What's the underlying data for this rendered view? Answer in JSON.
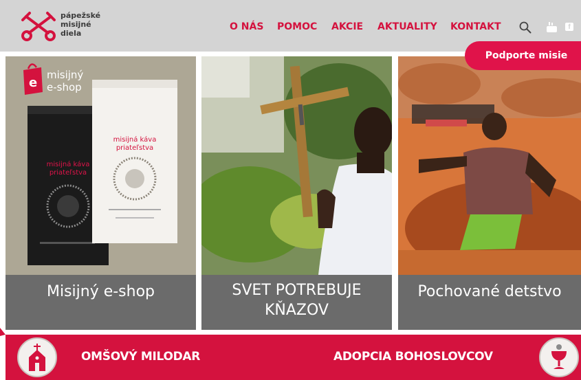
{
  "header": {
    "logo_lines": [
      "pápežské",
      "misijné",
      "diela"
    ],
    "nav": [
      "O NÁS",
      "POMOC",
      "AKCIE",
      "AKTUALITY",
      "KONTAKT"
    ],
    "support_button": "Podporte misie",
    "icons": [
      "search-icon",
      "youtube-icon",
      "facebook-icon"
    ]
  },
  "tiles": [
    {
      "caption": "Misijný e-shop",
      "image_text": {
        "brand_line1": "misijný",
        "brand_line2": "e-shop",
        "brand_badge": "e",
        "bag_text_line1": "misijná káva",
        "bag_text_line2": "priateľstva"
      }
    },
    {
      "caption_line1": "SVET POTREBUJE",
      "caption_line2": "KŇAZOV"
    },
    {
      "caption": "Pochované detstvo"
    }
  ],
  "banner": {
    "left_label": "OMŠOVÝ MILODAR",
    "right_label": "ADOPCIA BOHOSLOVCOV",
    "icons": [
      "church-icon",
      "chalice-icon"
    ]
  },
  "colors": {
    "accent": "#d4123e",
    "header_bg": "#d4d4d4",
    "caption_bg": "#6b6b6b"
  }
}
